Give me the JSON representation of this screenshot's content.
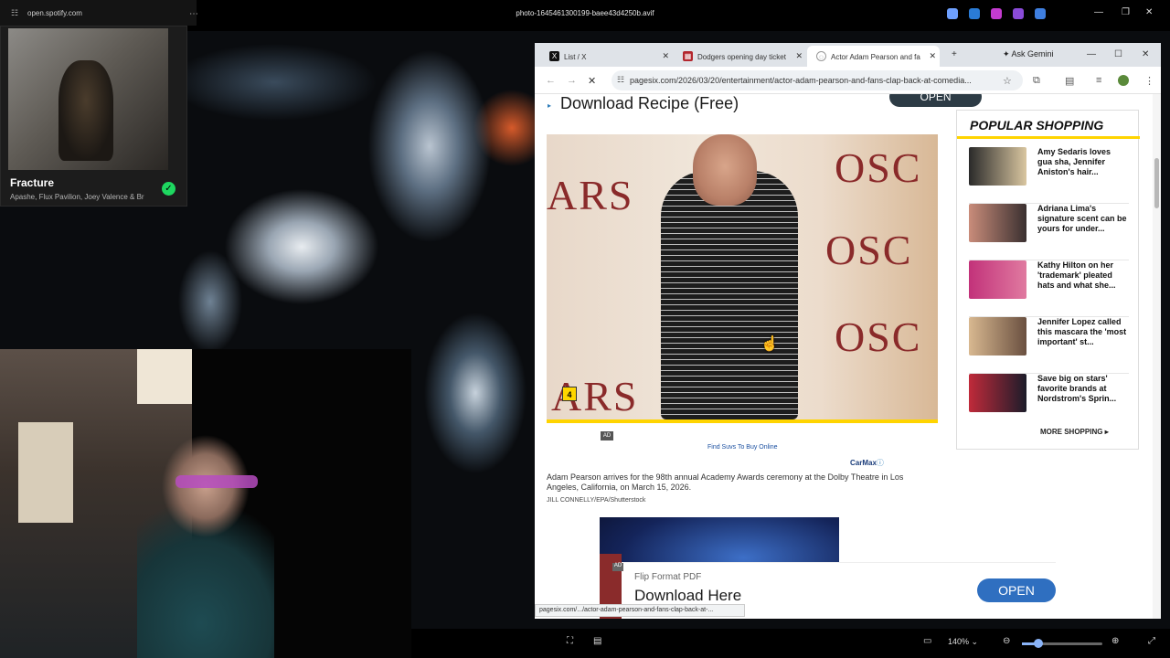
{
  "viewer": {
    "title": "photo-1645461300199-baee43d4250b.avif",
    "zoom": "140%",
    "zoom_level": 0.2
  },
  "spotify": {
    "url": "open.spotify.com",
    "song": "Fracture",
    "artist": "Apashe, Flux Pavilion, Joey Valence & Br"
  },
  "browser": {
    "tabs": [
      {
        "label": "List / X"
      },
      {
        "label": "Dodgers opening day ticket"
      },
      {
        "label": "Actor Adam Pearson and fa"
      }
    ],
    "ask_gemini": "Ask Gemini",
    "address": "pagesix.com/2026/03/20/entertainment/actor-adam-pearson-and-fans-clap-back-at-comedia...",
    "status_url": "pagesix.com/.../actor-adam-pearson-and-fans-clap-back-at-..."
  },
  "article": {
    "banner_text": "Download Recipe (Free)",
    "banner_open": "OPEN",
    "photo_badge": "4",
    "ad_tag": "AD",
    "ad_link": "Find Suvs To Buy Online",
    "ad_brand": "CarMax",
    "caption": "Adam Pearson arrives for the 98th annual Academy Awards ceremony at the Dolby Theatre in Los Angeles, California, on March 15, 2026.",
    "credit": "JILL CONNELLY/EPA/Shutterstock",
    "bottom_ad": {
      "label": "AD",
      "subtitle": "Flip Format PDF",
      "headline": "Download Here",
      "open": "OPEN"
    }
  },
  "sidebar": {
    "title": "POPULAR SHOPPING",
    "items": [
      {
        "text": "Amy Sedaris loves gua sha, Jennifer Aniston's hair..."
      },
      {
        "text": "Adriana Lima's signature scent can be yours for under..."
      },
      {
        "text": "Kathy Hilton on her 'trademark' pleated hats and what she..."
      },
      {
        "text": "Jennifer Lopez called this mascara the 'most important' st..."
      },
      {
        "text": "Save big on stars' favorite brands at Nordstrom's Sprin..."
      }
    ],
    "more": "MORE SHOPPING"
  }
}
